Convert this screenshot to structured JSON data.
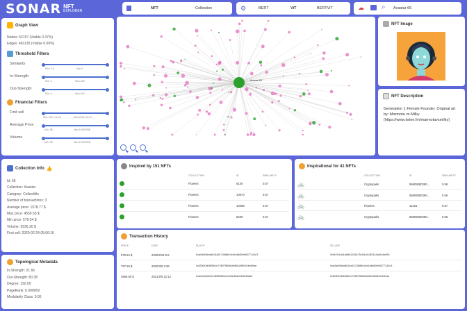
{
  "app": {
    "name": "SONAR",
    "sub1": "NFT",
    "sub2": "EXPLORER"
  },
  "header": {
    "mode_tabs": [
      "NFT",
      "Collection"
    ],
    "model_tabs": [
      "BERT",
      "ViT",
      "BERTViT"
    ],
    "search_value": "Avastar 66"
  },
  "graph_view": {
    "title": "Graph View",
    "nodes": "Nodes:  52157 (Visible 0.37%)",
    "edges": "Edges:  481130 (Visible 0.09%)"
  },
  "threshold": {
    "title": "Threshold Filters",
    "sliders": [
      {
        "label": "Similarity",
        "min": "Min: 0.5",
        "max": "Max:1"
      },
      {
        "label": "In-Strength",
        "min": "Min: 0",
        "max": "Max:320"
      },
      {
        "label": "Out-Strength",
        "min": "Min: 0",
        "max": "Max:320"
      }
    ]
  },
  "financial": {
    "title": "Financial Filters",
    "sliders": [
      {
        "label": "First sell",
        "min": "Min: 2017-11-23",
        "max": "Max:2021-04-27"
      },
      {
        "label": "Average Price",
        "min": "Min: 0$",
        "max": "Max:1000000$"
      },
      {
        "label": "Volume",
        "min": "Min: 0$",
        "max": "Max:1000000$"
      }
    ]
  },
  "graph": {
    "center_label": "Avastar 66"
  },
  "nft_image": {
    "title": "NFT Image"
  },
  "nft_description": {
    "title": "NFT Description",
    "text": "Generation 1 Female Founder. Original art by: Marmota vs Milky (https://www.twine.fm/marmotavsmilky)"
  },
  "collection_info": {
    "title": "Collection Info",
    "rows": [
      "Id:   66",
      "Collection:   Avastar",
      "Category:   Collectible",
      "Number of transactions:   3",
      "Average price:   1578.77 $",
      "Max price:   4559.50 $",
      "Min price:   579.54 $",
      "Volume:   5936.30 $",
      "First sell:   2020-02-24 05:06:16"
    ]
  },
  "topological": {
    "title": "Topological Metadata",
    "rows": [
      "In-Strength:   21.66",
      "Out-Strength:   80.38",
      "Degree:   192.00",
      "PageRank:   0.000069",
      "Modularity Class:   0.00"
    ]
  },
  "inspired_by": {
    "title": "Inspired by 151 NFTs",
    "headers": [
      "COLLECTION",
      "ID",
      "SIMILARITY"
    ],
    "rows": [
      [
        "Flowers",
        "6140",
        "0.57"
      ],
      [
        "Flowers",
        "10670",
        "0.57"
      ],
      [
        "Flowers",
        "10468",
        "0.57"
      ],
      [
        "Flowers",
        "5239",
        "0.57"
      ]
    ]
  },
  "inspirational": {
    "title": "Inspirational for 41 NFTs",
    "headers": [
      "COLLECTION",
      "ID",
      "SIMILARITY"
    ],
    "rows": [
      [
        "Cryptopaks",
        "55805080280...",
        "0.58"
      ],
      [
        "Cryptopaks",
        "55805080280...",
        "0.58"
      ],
      [
        "Flowers",
        "11331",
        "0.57"
      ],
      [
        "Cryptopaks",
        "55805080280...",
        "0.58"
      ]
    ]
  },
  "transactions": {
    "title": "Transaction History",
    "headers": [
      "PRICE",
      "DATE",
      "BUYER",
      "SELLER"
    ],
    "rows": [
      [
        "579.54 $",
        "2020/2/24 5:6",
        "0xa0a5b8edd614a5174688e2eb1b6b85ef8577142c3",
        "0x0b7b44a1eb8d1445c75c54c0c3f0143a51ebef93"
      ],
      [
        "797.26 $",
        "2020/3/9 3:36",
        "0xf23f00d0b95b1b72807f8066a5f6d10f60b2be85ae",
        "0xa0a5b8edd614a5174688e2eb1b6b85ef8577142c3"
      ],
      [
        "4559.50 $",
        "2021/2/9 12:12",
        "0xd2cb06cf221df93554bc4e42245aeb63d426a2",
        "0xf23f00d0b95b1b72807f8066a5f6410f6b2be81ae"
      ]
    ]
  },
  "colors": {
    "accent": "#5b67d8",
    "green": "#2ca02c",
    "pink": "#e377c2"
  }
}
